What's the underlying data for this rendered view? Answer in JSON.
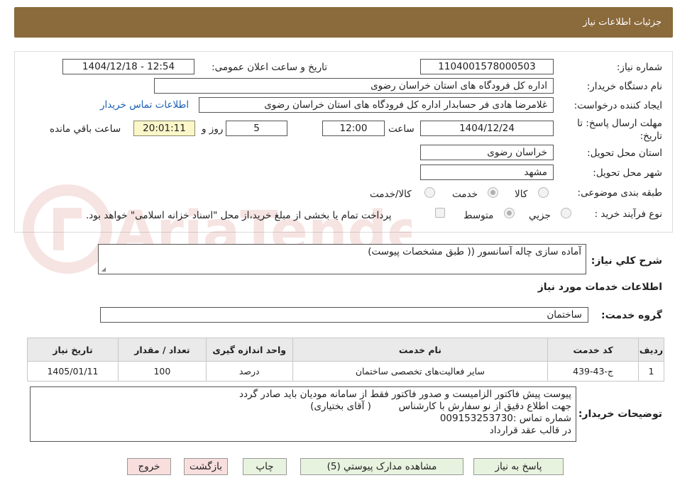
{
  "header": {
    "title": "جزئیات اطلاعات نیاز"
  },
  "form": {
    "need_number_label": "شماره نیاز:",
    "need_number": "1104001578000503",
    "announce_label": "تاریخ و ساعت اعلان عمومی:",
    "announce_value": "1404/12/18 - 12:54",
    "buyer_org_label": "نام دستگاه خریدار:",
    "buyer_org": "اداره کل فرودگاه های استان خراسان رضوی",
    "requester_label": "ایجاد کننده درخواست:",
    "requester": "غلامرضا هادی فر حسابدار اداره کل فرودگاه های استان خراسان رضوی",
    "contact_link": "اطلاعات تماس خریدار",
    "deadline_label_1": "مهلت ارسال پاسخ: تا",
    "deadline_label_2": "تاریخ:",
    "deadline_date": "1404/12/24",
    "time_label": "ساعت",
    "deadline_time": "12:00",
    "days_value": "5",
    "days_label": "روز و",
    "remaining_time": "20:01:11",
    "remaining_label": "ساعت باقي مانده",
    "province_label": "استان محل تحویل:",
    "province": "خراسان رضوی",
    "city_label": "شهر محل تحویل:",
    "city": "مشهد",
    "category_label": "طبقه بندی موضوعی:",
    "category_options": [
      "کالا",
      "خدمت",
      "کالا/خدمت"
    ],
    "category_selected": "خدمت",
    "process_label": "نوع فرآیند خرید :",
    "process_options": [
      "جزیي",
      "متوسط"
    ],
    "process_selected": "متوسط",
    "payment_note": "پرداخت تمام یا بخشی از مبلغ خرید،از محل \"اسناد خزانه اسلامی\" خواهد بود."
  },
  "description": {
    "label": "شرح کلي نیاز:",
    "value": "آماده سازی چاله آسانسور (( طبق مشخصات پیوست)"
  },
  "services": {
    "section_title": "اطلاعات خدمات مورد نیاز",
    "group_label": "گروه خدمت:",
    "group_value": "ساختمان",
    "columns": [
      "ردیف",
      "کد خدمت",
      "نام خدمت",
      "واحد اندازه گیری",
      "تعداد / مقدار",
      "تاریخ نیاز"
    ],
    "rows": [
      {
        "index": "1",
        "code": "ج-43-439",
        "name": "سایر فعالیت‌های تخصصی ساختمان",
        "unit": "درصد",
        "qty": "100",
        "date": "1405/01/11"
      }
    ]
  },
  "buyer_notes": {
    "label": "توضیحات خریدار:",
    "lines": [
      "پیوست پیش فاکتور الزامیست و صدور فاکتور فقط از سامانه مودیان باید صادر گردد",
      "جهت اطلاع دقیق از نو سفارش با کارشناس         ( آقای بختیاری)",
      "شماره تماس :009153253730",
      "در قالب عقد قرارداد"
    ]
  },
  "buttons": {
    "reply": "پاسخ به نیاز",
    "attachments": "مشاهده مدارک پیوستي (5)",
    "print": "چاپ",
    "back": "بازگشت",
    "exit": "خروج"
  },
  "watermark": {
    "text": "AriaTender.neT"
  },
  "colors": {
    "header_bg": "#8b6a3c",
    "timer_bg": "#fbf7c9",
    "button_green": "#e8f3df",
    "button_red": "#f9dede",
    "link": "#1a5fb4"
  }
}
